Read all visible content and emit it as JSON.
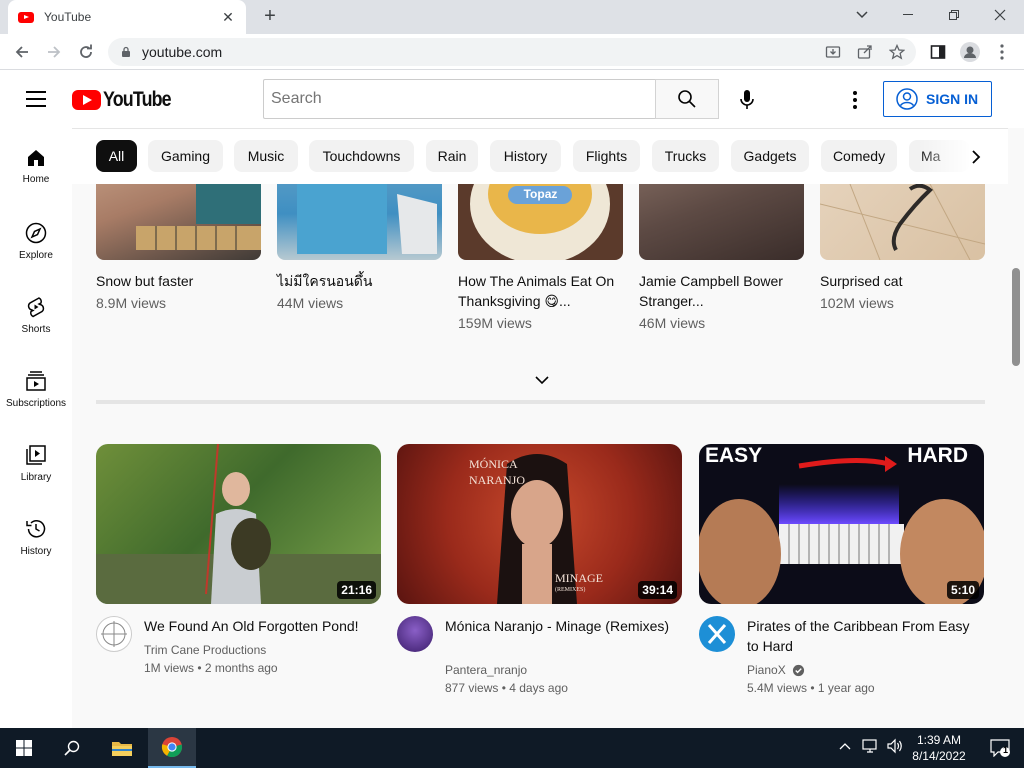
{
  "browser": {
    "tab_title": "YouTube",
    "tab_close": "✕",
    "new_tab": "+",
    "url": "youtube.com"
  },
  "youtube": {
    "logo_text": "YouTube",
    "search_placeholder": "Search",
    "sign_in_label": "SIGN IN",
    "brand_color": "#ff0000",
    "link_color": "#065fd4"
  },
  "chips": [
    "All",
    "Gaming",
    "Music",
    "Touchdowns",
    "Rain",
    "History",
    "Flights",
    "Trucks",
    "Gadgets",
    "Comedy",
    "Ma"
  ],
  "sidebar": [
    {
      "label": "Home",
      "icon": "home-icon"
    },
    {
      "label": "Explore",
      "icon": "compass-icon"
    },
    {
      "label": "Shorts",
      "icon": "shorts-icon"
    },
    {
      "label": "Subscriptions",
      "icon": "subscriptions-icon"
    },
    {
      "label": "Library",
      "icon": "library-icon"
    },
    {
      "label": "History",
      "icon": "history-icon"
    }
  ],
  "shorts": [
    {
      "title": "Snow but faster",
      "views": "8.9M views"
    },
    {
      "title": "ไม่มีใครนอนดึ้น",
      "views": "44M views"
    },
    {
      "title": "How The Animals Eat On Thanksgiving 😋...",
      "views": "159M views"
    },
    {
      "title": "Jamie Campbell Bower Stranger...",
      "views": "46M views"
    },
    {
      "title": "Surprised cat",
      "views": "102M views"
    }
  ],
  "videos": [
    {
      "title": "We Found An Old Forgotten Pond!",
      "channel": "Trim Cane Productions",
      "meta": "1M views • 2 months ago",
      "duration": "21:16",
      "verified": false
    },
    {
      "title": "Mónica Naranjo - Minage (Remixes)",
      "channel": "Pantera_nranjo",
      "meta": "877 views • 4 days ago",
      "duration": "39:14",
      "verified": false
    },
    {
      "title": "Pirates of the Caribbean From Easy to Hard",
      "channel": "PianoX",
      "meta": "5.4M views • 1 year ago",
      "duration": "5:10",
      "verified": true
    }
  ],
  "thumb_text": {
    "monica_line1": "MÓNICA",
    "monica_line2": "NARANJO",
    "monica_art1": "MINAGE",
    "monica_art2": "(REMIXES)",
    "pirates_left": "EASY",
    "pirates_right": "HARD",
    "short3_label": "Topaz"
  },
  "taskbar": {
    "time": "1:39 AM",
    "date": "8/14/2022",
    "notifications": "1"
  }
}
